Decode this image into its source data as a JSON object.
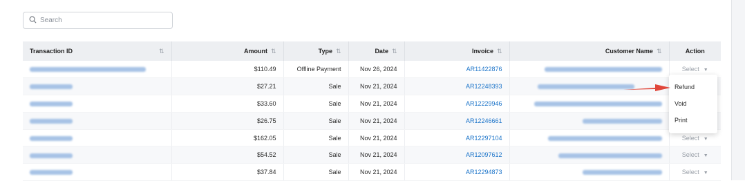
{
  "search": {
    "placeholder": "Search"
  },
  "table": {
    "headers": {
      "transaction_id": "Transaction ID",
      "amount": "Amount",
      "type": "Type",
      "date": "Date",
      "invoice": "Invoice",
      "customer_name": "Customer Name",
      "action": "Action"
    },
    "sort_glyph": "⇅",
    "rows": [
      {
        "amount": "$110.49",
        "type": "Offline Payment",
        "date": "Nov 26, 2024",
        "invoice": "AR11422876",
        "action": "Select"
      },
      {
        "amount": "$27.21",
        "type": "Sale",
        "date": "Nov 21, 2024",
        "invoice": "AR12248393",
        "action": ""
      },
      {
        "amount": "$33.60",
        "type": "Sale",
        "date": "Nov 21, 2024",
        "invoice": "AR12229946",
        "action": ""
      },
      {
        "amount": "$26.75",
        "type": "Sale",
        "date": "Nov 21, 2024",
        "invoice": "AR12246661",
        "action": ""
      },
      {
        "amount": "$162.05",
        "type": "Sale",
        "date": "Nov 21, 2024",
        "invoice": "AR12297104",
        "action": "Select"
      },
      {
        "amount": "$54.52",
        "type": "Sale",
        "date": "Nov 21, 2024",
        "invoice": "AR12097612",
        "action": "Select"
      },
      {
        "amount": "$37.84",
        "type": "Sale",
        "date": "Nov 21, 2024",
        "invoice": "AR12294873",
        "action": "Select"
      }
    ]
  },
  "action_menu": {
    "items": [
      "Refund",
      "Void",
      "Print"
    ]
  },
  "colors": {
    "link": "#1a73c9",
    "arrow": "#e0463a",
    "header_bg": "#edeff2"
  },
  "icons": {
    "search": "search-icon",
    "sort": "sort-icon",
    "caret": "caret-down-icon",
    "annotation": "red-arrow-icon"
  }
}
